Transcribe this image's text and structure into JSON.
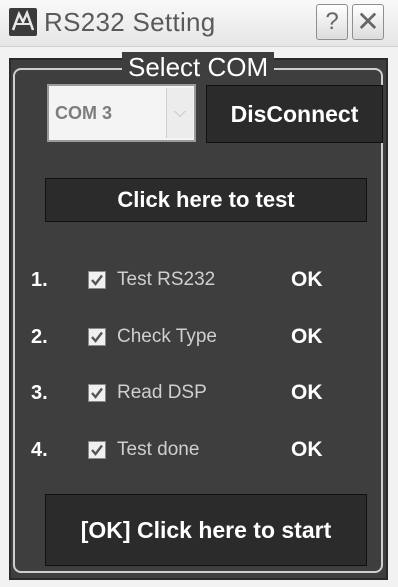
{
  "window": {
    "title": "RS232 Setting",
    "help_label": "?",
    "close_label": "✕",
    "icon": "app-logo-icon"
  },
  "group": {
    "title": "Select COM"
  },
  "com": {
    "selected": "COM 3",
    "arrow": "⌵"
  },
  "buttons": {
    "disconnect": "DisConnect",
    "test": "Click here to test",
    "start": "[OK] Click here to start"
  },
  "steps": [
    {
      "number": "1.",
      "label": "Test RS232",
      "status": "OK",
      "checked": true
    },
    {
      "number": "2.",
      "label": "Check Type",
      "status": "OK",
      "checked": true
    },
    {
      "number": "3.",
      "label": "Read DSP",
      "status": "OK",
      "checked": true
    },
    {
      "number": "4.",
      "label": "Test done",
      "status": "OK",
      "checked": true
    }
  ]
}
